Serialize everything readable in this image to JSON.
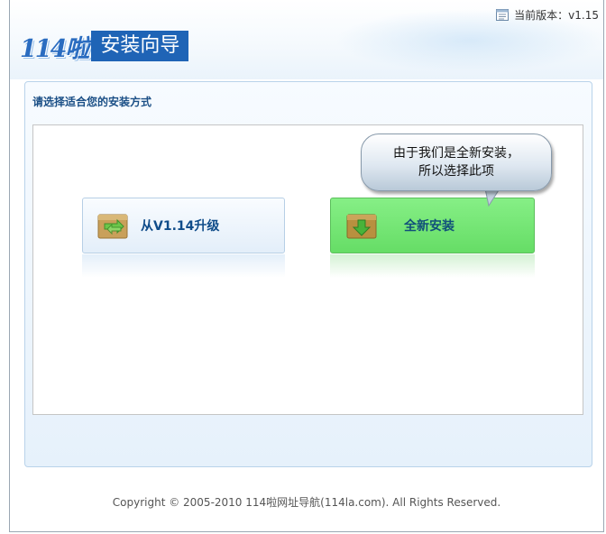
{
  "header": {
    "version_label": "当前版本：v1.15",
    "logo_brand": "114啦",
    "logo_title": "安装向导"
  },
  "panel": {
    "title": "请选择适合您的安装方式"
  },
  "options": {
    "upgrade_label": "从V1.14升级",
    "new_install_label": "全新安装"
  },
  "callout": {
    "line1": "由于我们是全新安装，",
    "line2": "所以选择此项"
  },
  "footer": {
    "copyright": "Copyright © 2005-2010 114啦网址导航(114la.com). All Rights Reserved."
  },
  "colors": {
    "brand_blue": "#1f64b6",
    "selected_green": "#77e877",
    "title_text": "#1b4f86"
  }
}
